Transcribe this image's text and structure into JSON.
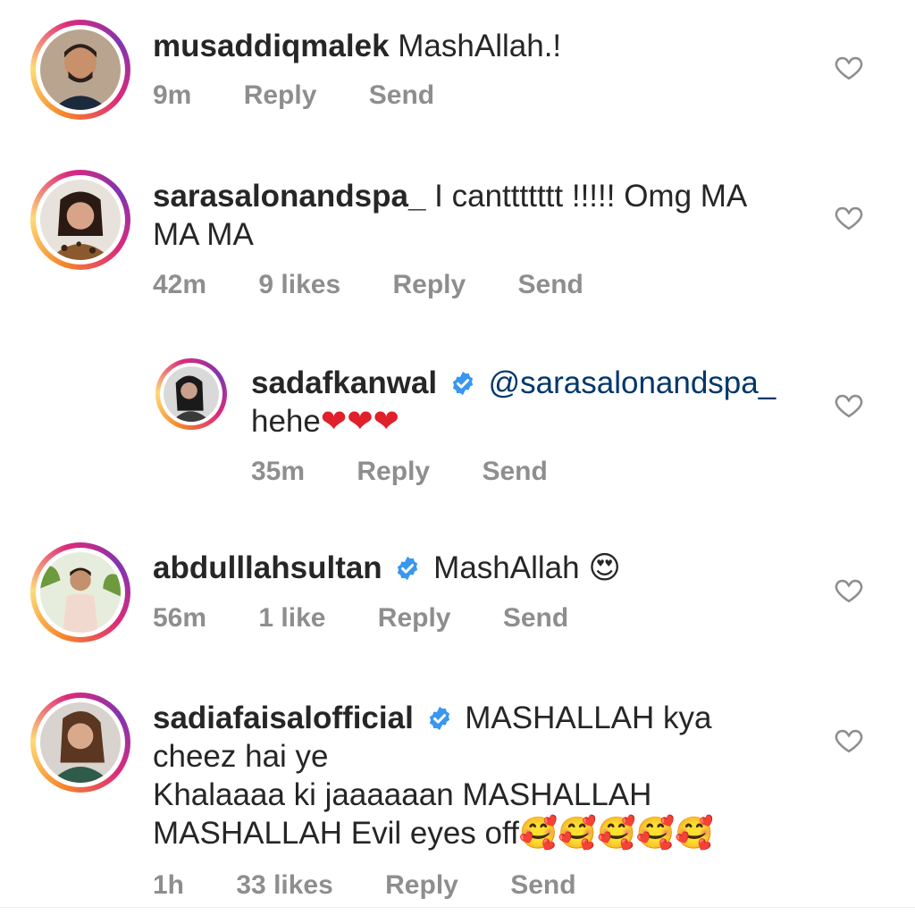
{
  "comments": [
    {
      "username": "musaddiqmalek",
      "text": "MashAllah.!",
      "time": "9m",
      "reply": "Reply",
      "send": "Send"
    },
    {
      "username": "sarasalonandspa_",
      "text": "I canttttttt !!!!! Omg MA MA MA",
      "time": "42m",
      "likes": "9 likes",
      "reply": "Reply",
      "send": "Send"
    },
    {
      "username": "sadafkanwal",
      "mention": "@sarasalonandspa_",
      "text": "hehe",
      "emoji": "❤❤❤",
      "time": "35m",
      "reply": "Reply",
      "send": "Send"
    },
    {
      "username": "abdulllahsultan",
      "text": "MashAllah",
      "emoji": "😍",
      "time": "56m",
      "likes": "1 like",
      "reply": "Reply",
      "send": "Send"
    },
    {
      "username": "sadiafaisalofficial",
      "text_line1": "MASHALLAH kya",
      "text_line2": "cheez hai ye",
      "text_line3": "Khalaaaa ki jaaaaaan MASHALLAH",
      "text_line4": "MASHALLAH Evil eyes off",
      "emoji": "🥰🥰🥰🥰🥰",
      "time": "1h",
      "likes": "33 likes",
      "reply": "Reply",
      "send": "Send"
    }
  ],
  "colors": {
    "text": "#262626",
    "meta": "#8e8e8e",
    "mention": "#00376b",
    "verified": "#3897f0"
  },
  "icons": {
    "like": "heart-outline-icon",
    "verified": "verified-badge-icon"
  }
}
